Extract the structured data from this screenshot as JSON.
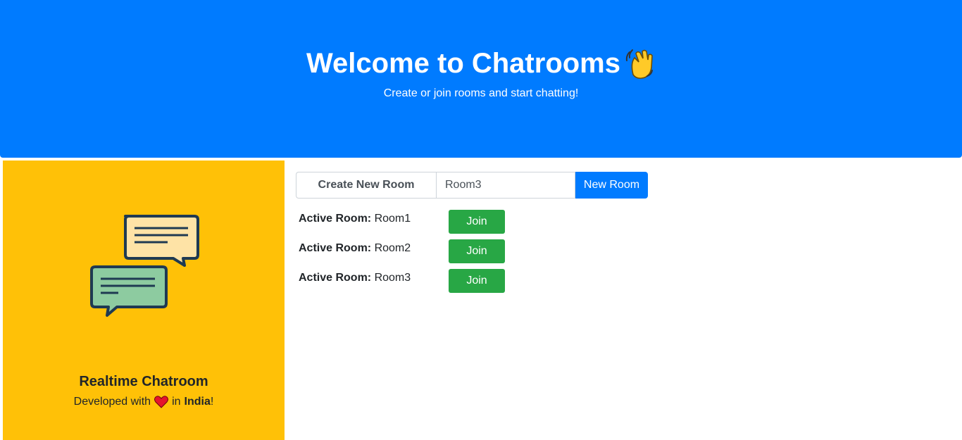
{
  "header": {
    "title": "Welcome to Chatrooms",
    "subtitle": "Create or join rooms and start chatting!"
  },
  "side_card": {
    "title": "Realtime Chatroom",
    "credit_prefix": "Developed with",
    "credit_middle": "in",
    "credit_country": "India",
    "credit_suffix": "!"
  },
  "create_room": {
    "label": "Create New Room",
    "input_value": "Room3",
    "button_label": "New Room"
  },
  "rooms": [
    {
      "label": "Active Room:",
      "name": "Room1",
      "button_label": "Join"
    },
    {
      "label": "Active Room:",
      "name": "Room2",
      "button_label": "Join"
    },
    {
      "label": "Active Room:",
      "name": "Room3",
      "button_label": "Join"
    }
  ],
  "icons": {
    "title_icon": "waving-hand-icon",
    "credit_icon": "heart-icon",
    "illustration": "chat-bubbles-illustration"
  },
  "colors": {
    "primary": "#007bff",
    "warning": "#ffc107",
    "success": "#28a745"
  }
}
